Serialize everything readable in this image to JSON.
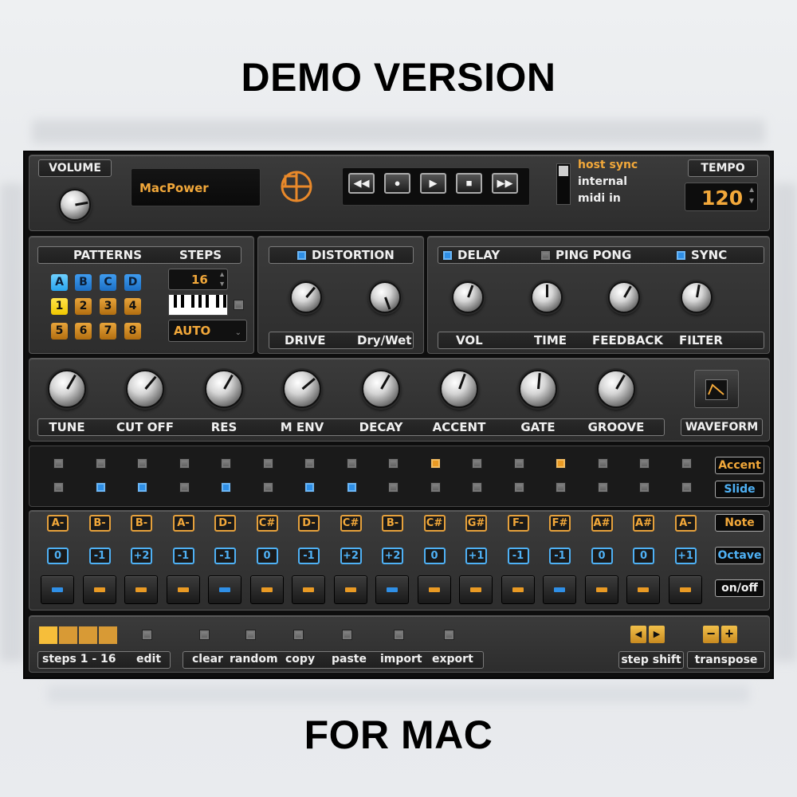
{
  "headline_top": "DEMO VERSION",
  "headline_bottom": "FOR MAC",
  "plugin": {
    "volume_label": "VOLUME",
    "preset_name": "MacPower",
    "tempo_label": "TEMPO",
    "tempo_value": "120",
    "sync_options": [
      "host sync",
      "internal",
      "midi in"
    ],
    "sync_selected": "host sync",
    "transport_icons": [
      "rewind-icon",
      "record-icon",
      "play-icon",
      "stop-icon",
      "fast-forward-icon"
    ],
    "patterns": {
      "label": "PATTERNS",
      "steps_label": "STEPS",
      "banks": [
        "A",
        "B",
        "C",
        "D"
      ],
      "numbers": [
        "1",
        "2",
        "3",
        "4",
        "5",
        "6",
        "7",
        "8"
      ],
      "selected_bank": "A",
      "selected_number": "1",
      "steps_value": "16",
      "mode_value": "AUTO"
    },
    "distortion": {
      "label": "DISTORTION",
      "knobs": [
        "DRIVE",
        "Dry/Wet"
      ]
    },
    "delay": {
      "label": "DELAY",
      "ping_pong_label": "PING PONG",
      "sync_label": "SYNC",
      "knobs": [
        "VOL",
        "TIME",
        "FEEDBACK",
        "FILTER"
      ]
    },
    "synth_knobs": [
      "TUNE",
      "CUT OFF",
      "RES",
      "M ENV",
      "DECAY",
      "ACCENT",
      "GATE",
      "GROOVE"
    ],
    "waveform_label": "WAVEFORM",
    "sequencer": {
      "accent_label": "Accent",
      "slide_label": "Slide",
      "note_label": "Note",
      "octave_label": "Octave",
      "onoff_label": "on/off",
      "accent": [
        0,
        0,
        0,
        0,
        0,
        0,
        0,
        0,
        0,
        1,
        0,
        0,
        1,
        0,
        0,
        0
      ],
      "slide": [
        0,
        1,
        1,
        0,
        1,
        0,
        1,
        1,
        0,
        0,
        0,
        0,
        0,
        0,
        0,
        0
      ],
      "notes": [
        "A-",
        "B-",
        "B-",
        "A-",
        "D-",
        "C#",
        "D-",
        "C#",
        "B-",
        "C#",
        "G#",
        "F-",
        "F#",
        "A#",
        "A#",
        "A-"
      ],
      "octaves": [
        "0",
        "-1",
        "+2",
        "-1",
        "-1",
        "0",
        "-1",
        "+2",
        "+2",
        "0",
        "+1",
        "-1",
        "-1",
        "0",
        "0",
        "+1"
      ],
      "onoff_colors": [
        "blue",
        "orange",
        "orange",
        "orange",
        "blue",
        "orange",
        "orange",
        "orange",
        "blue",
        "orange",
        "orange",
        "orange",
        "blue",
        "orange",
        "orange",
        "orange"
      ]
    },
    "bottom": {
      "steps_range": "steps 1 - 16",
      "edit_label": "edit",
      "actions": [
        "clear",
        "random",
        "copy",
        "paste",
        "import",
        "export"
      ],
      "step_shift_label": "step shift",
      "transpose_label": "transpose"
    }
  },
  "colors": {
    "accent_orange": "#e99a24",
    "accent_blue": "#2f8fe6",
    "panel": "#333333"
  }
}
